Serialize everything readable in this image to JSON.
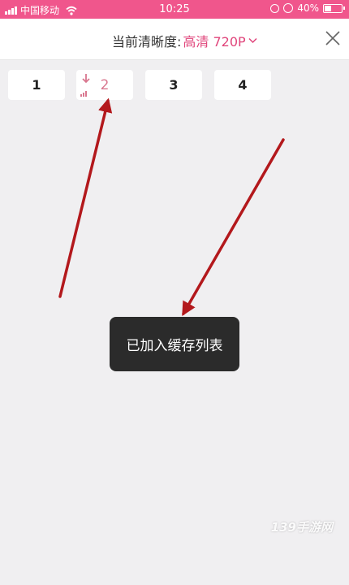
{
  "status_bar": {
    "carrier": "中国移动",
    "time": "10:25",
    "battery_text": "40%",
    "battery_level": 0.4,
    "icons": [
      "signal-icon",
      "wifi-icon",
      "rotation-lock-icon",
      "alarm-icon",
      "battery-icon"
    ]
  },
  "header": {
    "quality_label": "当前清晰度:",
    "quality_value": "高清 720P",
    "icons": [
      "chevron-down-icon",
      "close-icon"
    ]
  },
  "episodes": [
    {
      "label": "1",
      "state": "normal"
    },
    {
      "label": "2",
      "state": "downloading"
    },
    {
      "label": "3",
      "state": "normal"
    },
    {
      "label": "4",
      "state": "normal"
    }
  ],
  "toast": {
    "message": "已加入缓存列表"
  },
  "watermark": "139手游网",
  "colors": {
    "status_bar": "#f0568c",
    "accent": "#e0457b",
    "annotation_arrow": "#b3181c",
    "toast_bg": "#2b2b2b",
    "background": "#f0eff1"
  }
}
